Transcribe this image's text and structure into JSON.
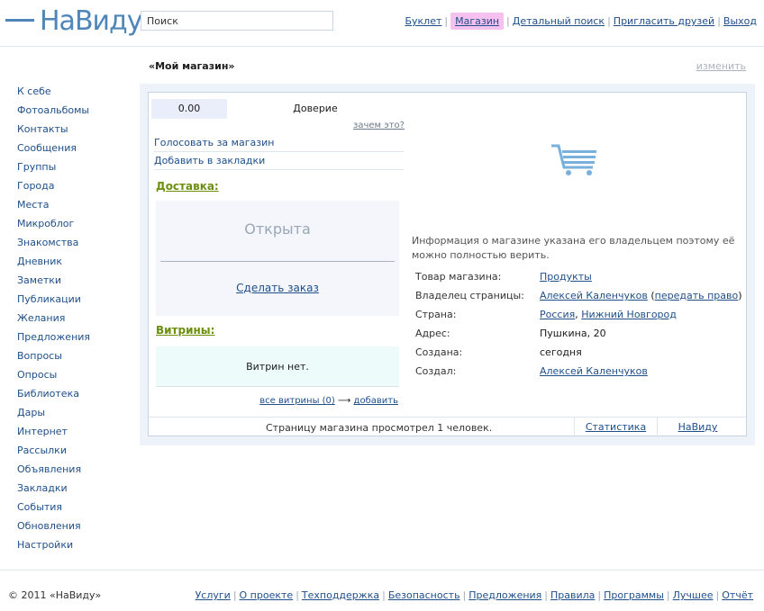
{
  "header": {
    "logo_text": "НаВиду",
    "search_placeholder": "Поиск",
    "nav": [
      "Буклет",
      "Магазин",
      "Детальный поиск",
      "Пригласить друзей",
      "Выход"
    ]
  },
  "sidebar": {
    "items": [
      "К себе",
      "Фотоальбомы",
      "Контакты",
      "Сообщения",
      "Группы",
      "Города",
      "Места",
      "Микроблог",
      "Знакомства",
      "Дневник",
      "Заметки",
      "Публикации",
      "Желания",
      "Предложения",
      "Вопросы",
      "Опросы",
      "Библиотека",
      "Дары",
      "Интернет",
      "Рассылки",
      "Объявления",
      "Закладки",
      "События",
      "Обновления",
      "Настройки"
    ]
  },
  "page": {
    "title": "«Мой магазин»",
    "edit": "изменить"
  },
  "rating": {
    "value": "0.00",
    "label": "Доверие",
    "why": "зачем это?"
  },
  "actions": {
    "vote": "Голосовать за магазин",
    "bookmark": "Добавить в закладки"
  },
  "delivery": {
    "heading": "Доставка:",
    "status": "Открыта",
    "order": "Сделать заказ"
  },
  "vitrines": {
    "heading": "Витрины:",
    "empty": "Витрин нет.",
    "all": "все витрины (0)",
    "arrow": "⟶",
    "add": "добавить"
  },
  "info": {
    "text": "Информация о магазине указана его владельцем поэтому её можно полностью верить.",
    "product_label": "Товар магазина:",
    "product": "Продукты",
    "owner_label": "Владелец страницы:",
    "owner": "Алексей Каленчуков",
    "transfer_open": "(",
    "transfer": "передать право",
    "transfer_close": ")",
    "country_label": "Страна:",
    "country": "Россия",
    "comma": ",",
    "city": "Нижний Новгород",
    "address_label": "Адрес:",
    "address": "Пушкина, 20",
    "created_label": "Создана:",
    "created": "сегодня",
    "creator_label": "Создал:",
    "creator": "Алексей Каленчуков"
  },
  "panel_footer": {
    "views": "Страницу магазина просмотрел 1 человек.",
    "stats": "Статистика",
    "navidu": "НаВиду"
  },
  "footer": {
    "copyright": "© 2011 «НаВиду»",
    "links": [
      "Услуги",
      "О проекте",
      "Техподдержка",
      "Безопасность",
      "Предложения",
      "Правила",
      "Программы",
      "Лучшее",
      "Отчёт"
    ]
  },
  "colors": {
    "brand": "#4f86b9",
    "link": "#1e4f8a",
    "section_heading": "#6c8f10",
    "active_nav_bg": "#f6c1ee",
    "cart_icon": "#7ab0dc"
  },
  "icons": {
    "cart": "shopping-cart-icon"
  }
}
